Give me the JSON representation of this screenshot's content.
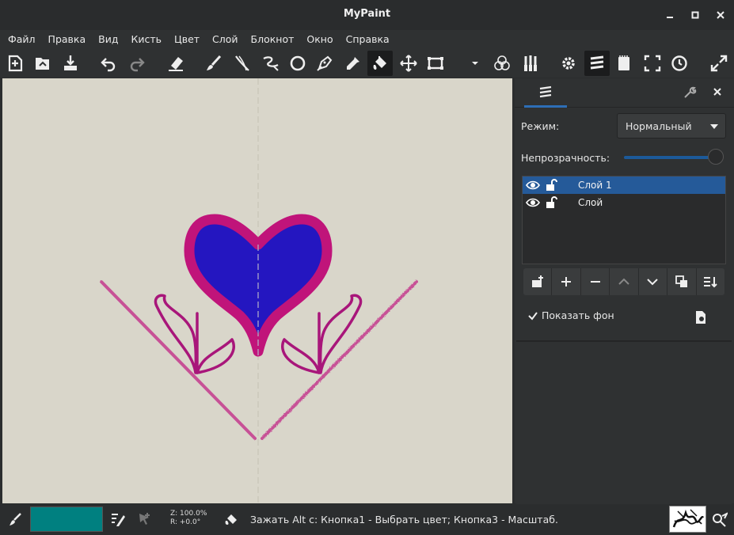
{
  "window": {
    "title": "MyPaint"
  },
  "menubar": {
    "items": [
      "Файл",
      "Правка",
      "Вид",
      "Кисть",
      "Цвет",
      "Слой",
      "Блокнот",
      "Окно",
      "Справка"
    ]
  },
  "toolbar": {
    "icons": [
      "new-file-icon",
      "open-file-icon",
      "save-file-icon",
      "undo-icon",
      "redo-icon",
      "eraser-icon",
      "brush-icon",
      "inking-icon",
      "freehand-icon",
      "ellipse-icon",
      "pen-icon",
      "color-picker-icon",
      "fill-bucket-icon",
      "move-icon",
      "frame-icon",
      "dropdown-icon",
      "color-blend-icon",
      "brushes-icon",
      "settings-icon",
      "layers-icon",
      "scratchpad-icon",
      "fullscreen-icon",
      "history-icon",
      "expand-icon"
    ]
  },
  "panel": {
    "mode_label": "Режим:",
    "mode_value": "Нормальный",
    "opacity_label": "Непрозрачность:",
    "opacity": 1.0,
    "layers": [
      {
        "name": "Слой 1",
        "selected": true
      },
      {
        "name": "Слой",
        "selected": false
      }
    ],
    "show_background_label": "Показать фон",
    "show_background": true
  },
  "status": {
    "color": "#008080",
    "zoom": "Z: 100.0%",
    "rotation": "R: +0.0°",
    "hint": "Зажать Alt с:  Кнопка1 - Выбрать цвет;  Кнопка3 - Масштаб."
  },
  "colors": {
    "heart_fill": "#2416c0",
    "heart_stroke": "#c0147a",
    "canvas_bg": "#d9d6ca",
    "accent": "#255a99"
  }
}
